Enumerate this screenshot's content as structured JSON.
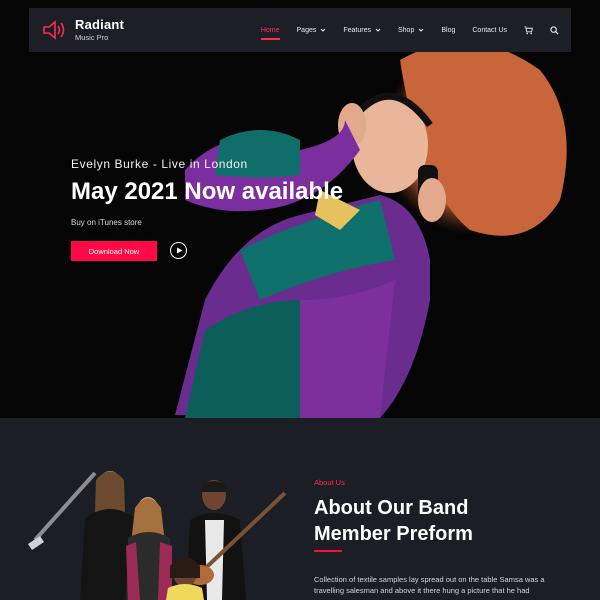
{
  "brand": {
    "title": "Radiant",
    "subtitle": "Music Pro"
  },
  "nav": {
    "items": [
      {
        "label": "Home",
        "active": true
      },
      {
        "label": "Pages",
        "dropdown": true
      },
      {
        "label": "Features",
        "dropdown": true
      },
      {
        "label": "Shop",
        "dropdown": true
      },
      {
        "label": "Blog"
      },
      {
        "label": "Contact Us"
      }
    ],
    "icons": [
      "cart-icon",
      "search-icon"
    ]
  },
  "hero": {
    "kicker": "Evelyn Burke - Live in London",
    "title": "May 2021 Now available",
    "subtitle": "Buy on iTunes store",
    "button": "Download Now"
  },
  "about": {
    "kicker": "About Us",
    "title_line1": "About Our Band",
    "title_line2": "Member Preform",
    "text": "Collection of textile samples lay spread out on the table Samsa was a travelling salesman and above it there hung a picture that he had"
  },
  "colors": {
    "accent": "#ff0a47",
    "nav_bg": "#1c1f26",
    "section_bg": "#1b1e25"
  }
}
